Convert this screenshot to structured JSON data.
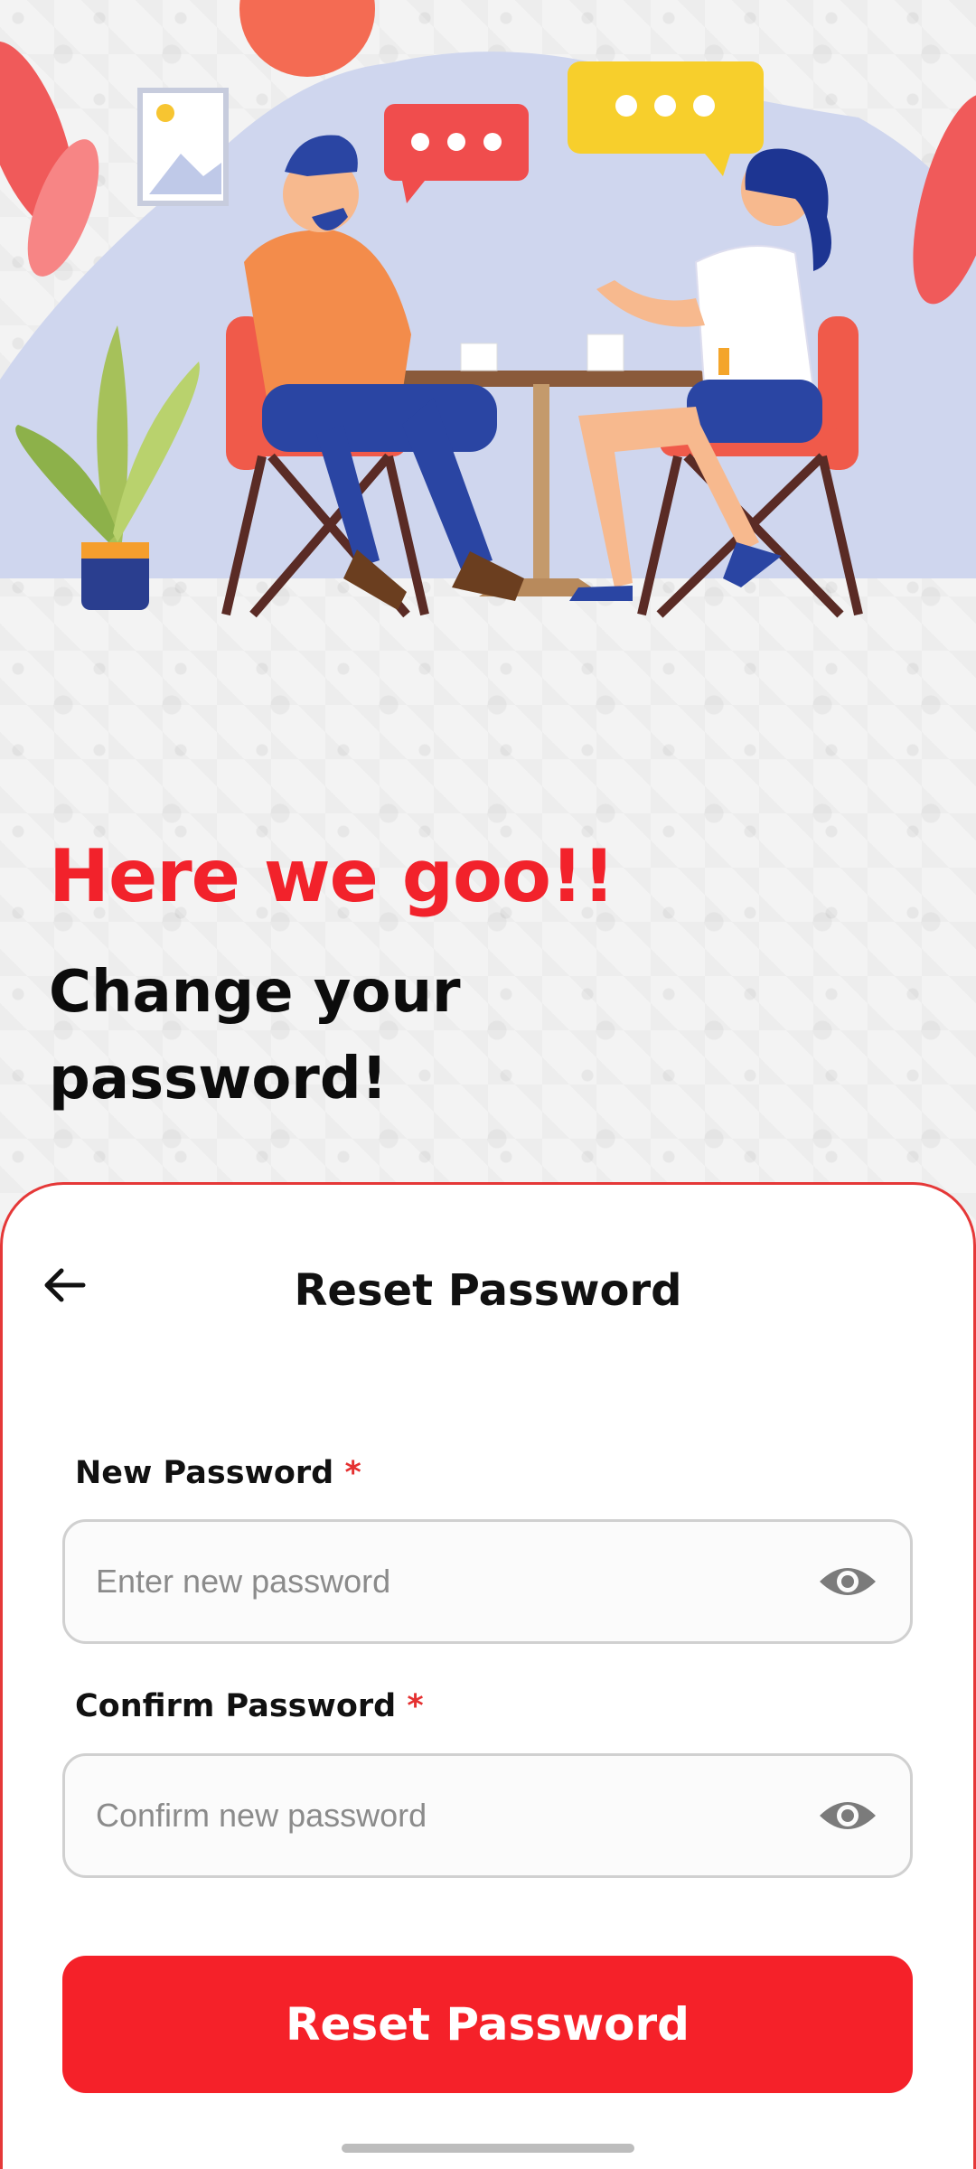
{
  "hero": {
    "headline": "Here we goo!!",
    "subhead": "Change your password!"
  },
  "sheet": {
    "title": "Reset Password",
    "new_password": {
      "label": "New Password",
      "required_mark": "*",
      "placeholder": "Enter new password",
      "value": ""
    },
    "confirm_password": {
      "label": "Confirm Password",
      "required_mark": "*",
      "placeholder": "Confirm new password",
      "value": ""
    },
    "submit_label": "Reset Password"
  },
  "icons": {
    "back": "arrow-left-icon",
    "toggle_visibility": "eye-icon"
  },
  "colors": {
    "accent": "#f52129",
    "headline": "#f2222b",
    "sheet_border": "#e53838"
  }
}
